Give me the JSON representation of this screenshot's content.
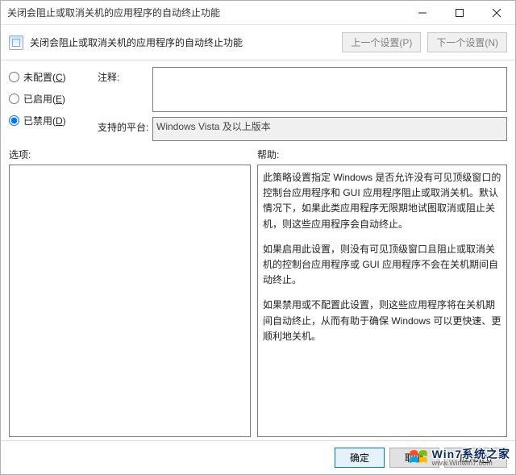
{
  "titlebar": {
    "title": "关闭会阻止或取消关机的应用程序的自动终止功能"
  },
  "subheader": {
    "title": "关闭会阻止或取消关机的应用程序的自动终止功能",
    "prev": "上一个设置(P)",
    "next": "下一个设置(N)"
  },
  "radios": [
    {
      "pre": "未配置(",
      "hk": "C",
      "post": ")"
    },
    {
      "pre": "已启用(",
      "hk": "E",
      "post": ")"
    },
    {
      "pre": "已禁用(",
      "hk": "D",
      "post": ")"
    }
  ],
  "selected_radio_index": 2,
  "fields": {
    "comment_label": "注释:",
    "comment_value": "",
    "platform_label": "支持的平台:",
    "platform_value": "Windows Vista 及以上版本"
  },
  "labels": {
    "options": "选项:",
    "help": "帮助:"
  },
  "help": {
    "p1": "此策略设置指定 Windows 是否允许没有可见顶级窗口的控制台应用程序和 GUI 应用程序阻止或取消关机。默认情况下，如果此类应用程序无限期地试图取消或阻止关机，则这些应用程序会自动终止。",
    "p2": "如果启用此设置，则没有可见顶级窗口且阻止或取消关机的控制台应用程序或 GUI 应用程序不会在关机期间自动终止。",
    "p3": "如果禁用或不配置此设置，则这些应用程序将在关机期间自动终止，从而有助于确保 Windows 可以更快速、更顺利地关机。"
  },
  "footer": {
    "ok": "确定",
    "cancel": "取消",
    "apply_pre": "应用(",
    "apply_hk": "A",
    "apply_post": ")"
  },
  "watermark": {
    "title": "Win7系统之家",
    "url": "www.Winwin7.com"
  }
}
